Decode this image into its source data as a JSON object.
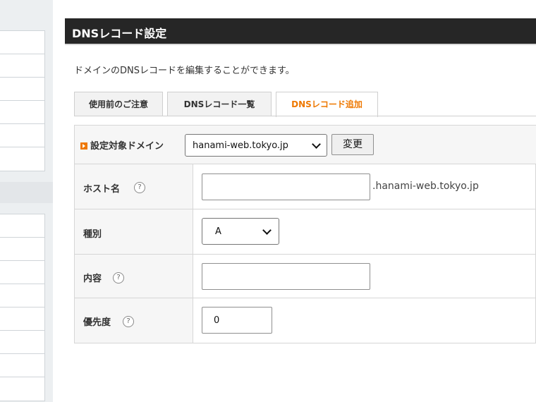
{
  "panel": {
    "title": "DNSレコード設定",
    "description": "ドメインのDNSレコードを編集することができます。"
  },
  "tabs": [
    {
      "label": "使用前のご注意",
      "active": false
    },
    {
      "label": "DNSレコード一覧",
      "active": false
    },
    {
      "label": "DNSレコード追加",
      "active": true
    }
  ],
  "domain_selector": {
    "label": "設定対象ドメイン",
    "selected": "hanami-web.tokyo.jp",
    "change_button": "変更"
  },
  "fields": {
    "host": {
      "label": "ホスト名",
      "value": "",
      "suffix": ".hanami-web.tokyo.jp"
    },
    "type": {
      "label": "種別",
      "selected": "A"
    },
    "content": {
      "label": "内容",
      "value": ""
    },
    "priority": {
      "label": "優先度",
      "value": "0"
    }
  },
  "help_glyph": "?",
  "colors": {
    "accent": "#ee7800",
    "title_bar": "#262626"
  },
  "icons": {
    "domain_marker": "orange-arrow-icon",
    "help": "question-circle-icon",
    "dropdown": "chevron-down-icon"
  }
}
